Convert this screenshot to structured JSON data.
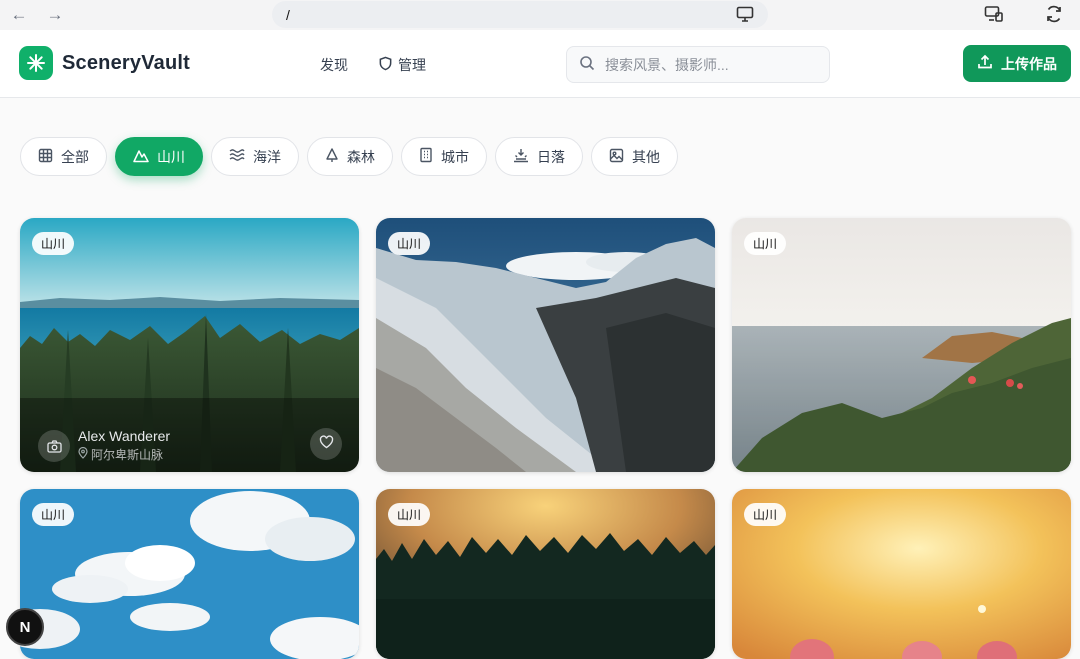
{
  "browser": {
    "url": "/"
  },
  "header": {
    "app_name": "SceneryVault",
    "nav": [
      {
        "label": "发现",
        "icon": ""
      },
      {
        "label": "管理",
        "icon": "shield-icon"
      }
    ],
    "search_placeholder": "搜索风景、摄影师...",
    "upload_label": "上传作品"
  },
  "categories": [
    {
      "label": "全部",
      "icon": "grid-icon",
      "active": false
    },
    {
      "label": "山川",
      "icon": "mountain-icon",
      "active": true
    },
    {
      "label": "海洋",
      "icon": "waves-icon",
      "active": false
    },
    {
      "label": "森林",
      "icon": "tree-icon",
      "active": false
    },
    {
      "label": "城市",
      "icon": "building-icon",
      "active": false
    },
    {
      "label": "日落",
      "icon": "sunset-icon",
      "active": false
    },
    {
      "label": "其他",
      "icon": "image-icon",
      "active": false
    }
  ],
  "photos": [
    {
      "tag": "山川",
      "photographer": "Alex Wanderer",
      "location": "阿尔卑斯山脉",
      "scene": "forest-coast"
    },
    {
      "tag": "山川",
      "scene": "snow-mountains"
    },
    {
      "tag": "山川",
      "scene": "rocky-coast"
    },
    {
      "tag": "山川",
      "scene": "blue-sky-clouds"
    },
    {
      "tag": "山川",
      "scene": "sunset-forest"
    },
    {
      "tag": "山川",
      "scene": "golden-bokeh"
    }
  ],
  "dev_badge": "N"
}
